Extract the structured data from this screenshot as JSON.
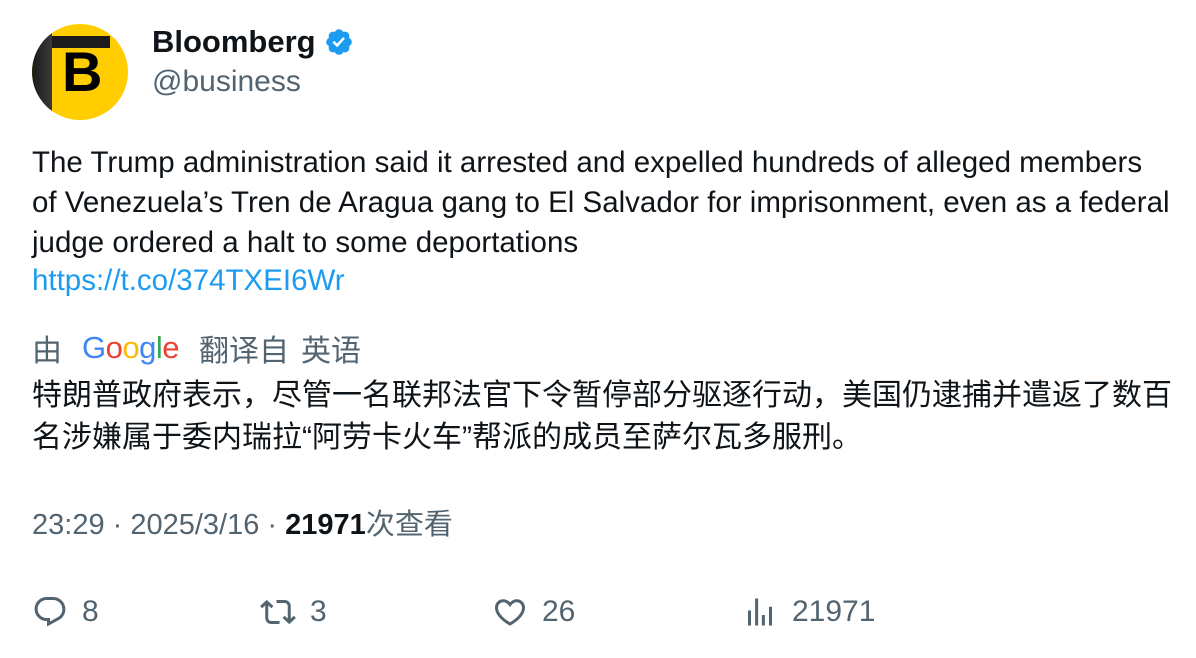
{
  "author": {
    "display_name": "Bloomberg",
    "handle": "@business",
    "avatar_letter": "B",
    "verified": true,
    "brand_color": "#ffcd00",
    "verified_color": "#1d9bf0"
  },
  "tweet": {
    "text": "The Trump administration said it arrested and expelled hundreds of alleged members of Venezuela’s Tren de Aragua gang to El Salvador for imprisonment, even as a federal judge ordered a halt to some deportations",
    "link": "https://t.co/374TXEI6Wr"
  },
  "translation": {
    "by": "由",
    "provider": "Google",
    "translated_from": "翻译自",
    "language": "英语",
    "text": "特朗普政府表示，尽管一名联邦法官下令暂停部分驱逐行动，美国仍逮捕并遣返了数百名涉嫌属于委内瑞拉“阿劳卡火车”帮派的成员至萨尔瓦多服刑。"
  },
  "meta": {
    "time": "23:29",
    "separator": " · ",
    "date": "2025/3/16",
    "views_count": "21971",
    "views_label": "次查看"
  },
  "actions": {
    "reply_icon": "reply-icon",
    "reply_count": "8",
    "retweet_icon": "retweet-icon",
    "retweet_count": "3",
    "like_icon": "heart-icon",
    "like_count": "26",
    "views_icon": "views-chart-icon",
    "views_count": "21971"
  },
  "colors": {
    "text": "#0f1419",
    "secondary": "#536471",
    "link": "#1d9bf0"
  }
}
